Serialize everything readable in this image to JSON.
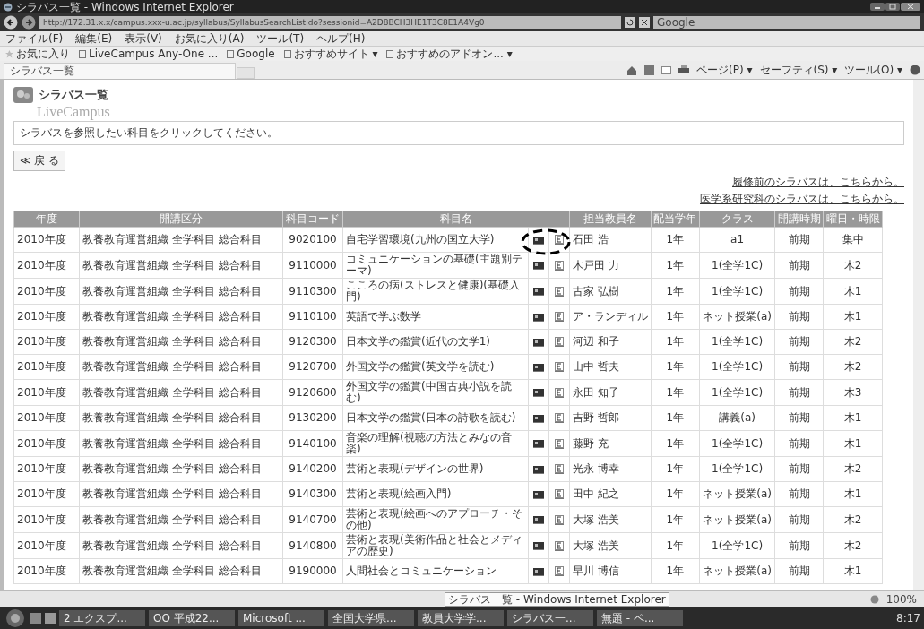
{
  "window": {
    "title": "シラバス一覧 - Windows Internet Explorer"
  },
  "address_bar": {
    "url": "http://172.31.x.x/campus.xxx-u.ac.jp/syllabus/SyllabusSearchList.do?sessionid=A2D8BCH3HE1T3C8E1A4Vg0",
    "search_placeholder": "Google"
  },
  "menu": [
    "ファイル(F)",
    "編集(E)",
    "表示(V)",
    "お気に入り(A)",
    "ツール(T)",
    "ヘルプ(H)"
  ],
  "favorites": [
    {
      "label": "お気に入り",
      "kind": "star"
    },
    {
      "label": "LiveCampus Any-One ...",
      "kind": "page"
    },
    {
      "label": "Google",
      "kind": "page"
    },
    {
      "label": "おすすめサイト ▾",
      "kind": "page"
    },
    {
      "label": "おすすめのアドオン... ▾",
      "kind": "page"
    }
  ],
  "tabs": [
    {
      "label": "シラバス一覧",
      "selected": true
    }
  ],
  "command_bar": [
    "ページ(P) ▾",
    "セーフティ(S) ▾",
    "ツール(O) ▾"
  ],
  "page": {
    "heading": "シラバス一覧",
    "watermark": "LiveCampus",
    "notice": "シラバスを参照したい科目をクリックしてください。",
    "back_button": "≪ 戻 る",
    "links": [
      "履修前のシラバスは、こちらから。",
      "医学系研究科のシラバスは、こちらから。"
    ]
  },
  "table": {
    "columns": [
      "年度",
      "開講区分",
      "科目コード",
      "科目名",
      "担当教員名",
      "配当学年",
      "クラス",
      "開講時期",
      "曜日・時限"
    ],
    "rows": [
      [
        "2010年度",
        "教養教育運営組織 全学科目 総合科目",
        "9020100",
        "自宅学習環境(九州の国立大学)",
        "石田 浩",
        "1年",
        "a1",
        "前期",
        "集中"
      ],
      [
        "2010年度",
        "教養教育運営組織 全学科目 総合科目",
        "9110000",
        "コミュニケーションの基礎(主題別テーマ)",
        "木戸田 力",
        "1年",
        "1(全学1C)",
        "前期",
        "木2"
      ],
      [
        "2010年度",
        "教養教育運営組織 全学科目 総合科目",
        "9110300",
        "こころの病(ストレスと健康)(基礎入門)",
        "古家 弘樹",
        "1年",
        "1(全学1C)",
        "前期",
        "木1"
      ],
      [
        "2010年度",
        "教養教育運営組織 全学科目 総合科目",
        "9110100",
        "英語で学ぶ数学",
        "ア・ランディル",
        "1年",
        "ネット授業(a)",
        "前期",
        "木1"
      ],
      [
        "2010年度",
        "教養教育運営組織 全学科目 総合科目",
        "9120300",
        "日本文学の鑑賞(近代の文学1)",
        "河辺 和子",
        "1年",
        "1(全学1C)",
        "前期",
        "木2"
      ],
      [
        "2010年度",
        "教養教育運営組織 全学科目 総合科目",
        "9120700",
        "外国文学の鑑賞(英文学を読む)",
        "山中 哲夫",
        "1年",
        "1(全学1C)",
        "前期",
        "木2"
      ],
      [
        "2010年度",
        "教養教育運営組織 全学科目 総合科目",
        "9120600",
        "外国文学の鑑賞(中国古典小説を読む)",
        "永田 知子",
        "1年",
        "1(全学1C)",
        "前期",
        "木3"
      ],
      [
        "2010年度",
        "教養教育運営組織 全学科目 総合科目",
        "9130200",
        "日本文学の鑑賞(日本の詩歌を読む)",
        "吉野 哲郎",
        "1年",
        "講義(a)",
        "前期",
        "木1"
      ],
      [
        "2010年度",
        "教養教育運営組織 全学科目 総合科目",
        "9140100",
        "音楽の理解(視聴の方法とみなの音楽)",
        "藤野 充",
        "1年",
        "1(全学1C)",
        "前期",
        "木1"
      ],
      [
        "2010年度",
        "教養教育運営組織 全学科目 総合科目",
        "9140200",
        "芸術と表現(デザインの世界)",
        "光永 博幸",
        "1年",
        "1(全学1C)",
        "前期",
        "木2"
      ],
      [
        "2010年度",
        "教養教育運営組織 全学科目 総合科目",
        "9140300",
        "芸術と表現(絵画入門)",
        "田中 紀之",
        "1年",
        "ネット授業(a)",
        "前期",
        "木1"
      ],
      [
        "2010年度",
        "教養教育運営組織 全学科目 総合科目",
        "9140700",
        "芸術と表現(絵画へのアプローチ・その他)",
        "大塚 浩美",
        "1年",
        "ネット授業(a)",
        "前期",
        "木2"
      ],
      [
        "2010年度",
        "教養教育運営組織 全学科目 総合科目",
        "9140800",
        "芸術と表現(美術作品と社会とメディアの歴史)",
        "大塚 浩美",
        "1年",
        "1(全学1C)",
        "前期",
        "木2"
      ],
      [
        "2010年度",
        "教養教育運営組織 全学科目 総合科目",
        "9190000",
        "人間社会とコミュニケーション",
        "早川 博信",
        "1年",
        "ネット授業(a)",
        "前期",
        "木1"
      ]
    ]
  },
  "status_bar": {
    "tooltip": "シラバス一覧 - Windows Internet Explorer",
    "zoom": "100%"
  },
  "taskbar": {
    "buttons": [
      "2 エクスプ...",
      "OO 平成22...",
      "Microsoft ...",
      "全国大学県...",
      "教員大学学...",
      "シラバス一...",
      "無題 - ペ..."
    ],
    "clock": "8:17"
  }
}
